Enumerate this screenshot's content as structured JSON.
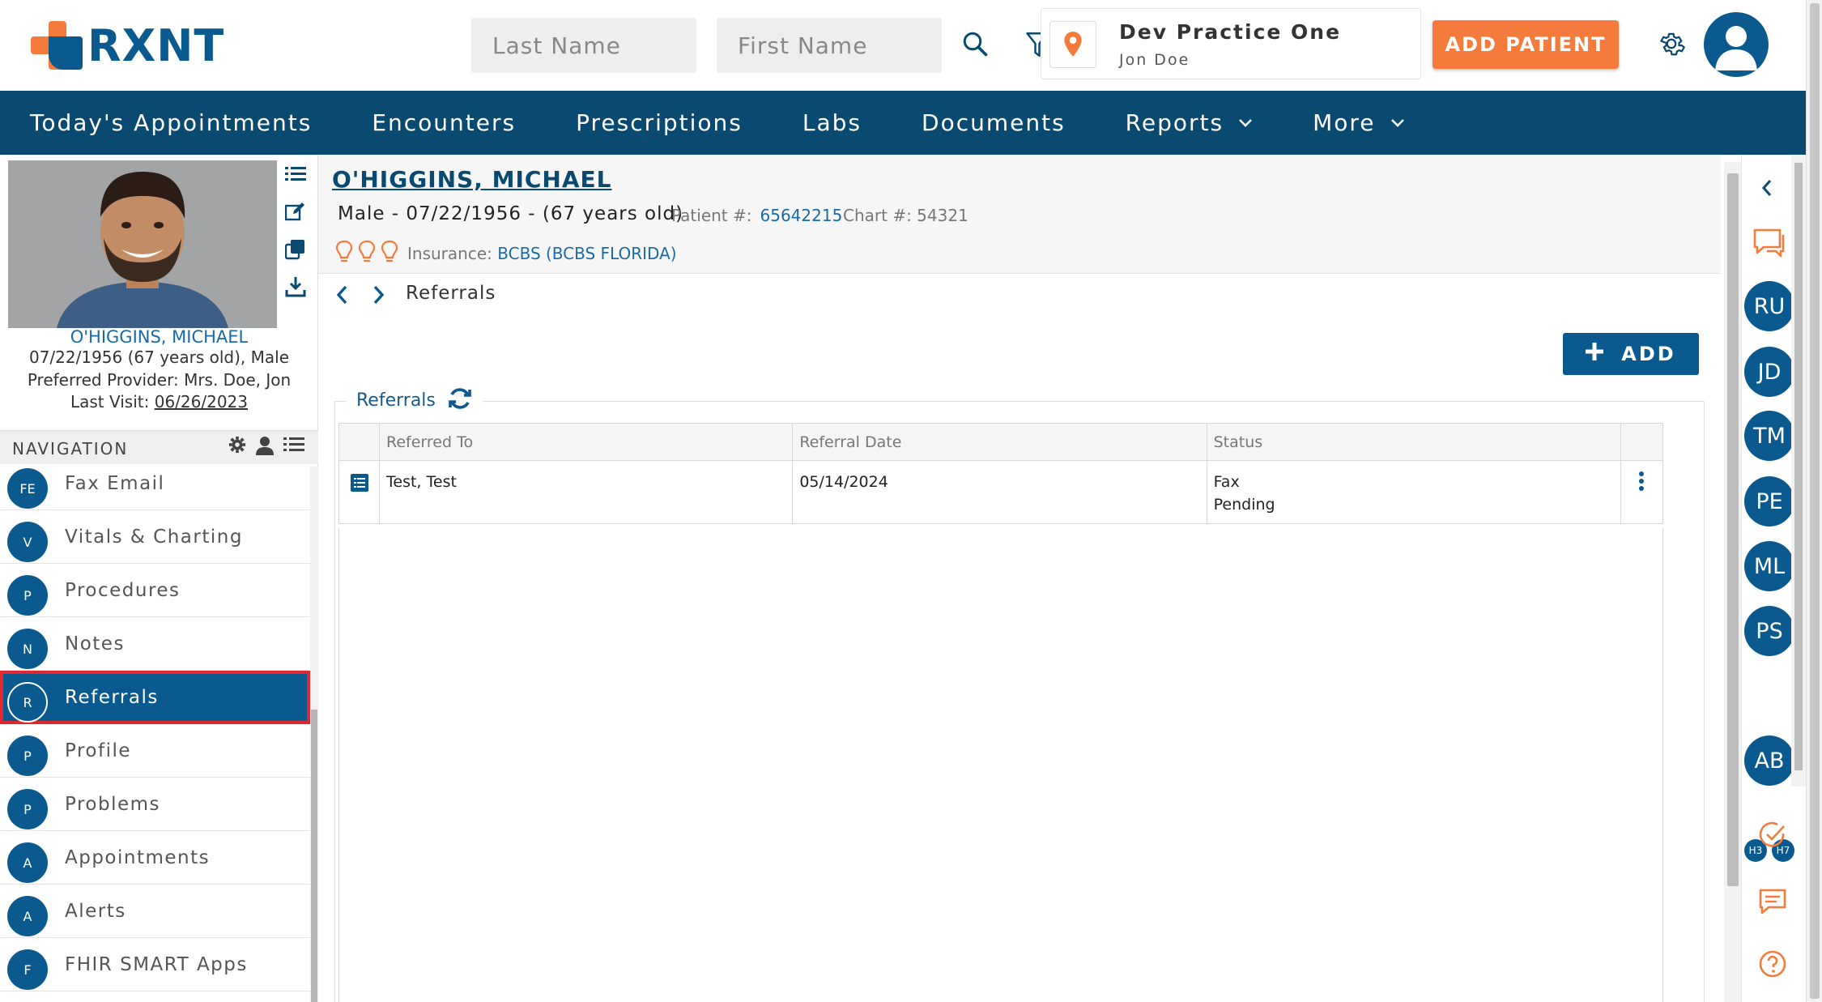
{
  "header": {
    "logo_text": "RXNT",
    "last_name_placeholder": "Last Name",
    "first_name_placeholder": "First Name",
    "practice_name": "Dev Practice One",
    "practice_user": "Jon Doe",
    "add_patient_label": "ADD PATIENT"
  },
  "mainnav": {
    "items": [
      {
        "label": "Today's Appointments"
      },
      {
        "label": "Encounters"
      },
      {
        "label": "Prescriptions"
      },
      {
        "label": "Labs"
      },
      {
        "label": "Documents"
      },
      {
        "label": "Reports"
      },
      {
        "label": "More"
      }
    ]
  },
  "patient_card": {
    "name": "O'HIGGINS, MICHAEL",
    "dob_line": "07/22/1956 (67 years old), Male",
    "provider_line": "Preferred Provider: Mrs. Doe, Jon",
    "last_visit_label": "Last Visit:",
    "last_visit_date": "06/26/2023"
  },
  "navigation": {
    "title": "NAVIGATION",
    "items": [
      {
        "abbr": "FE",
        "label": "Fax Email"
      },
      {
        "abbr": "V",
        "label": "Vitals & Charting"
      },
      {
        "abbr": "P",
        "label": "Procedures"
      },
      {
        "abbr": "N",
        "label": "Notes"
      },
      {
        "abbr": "R",
        "label": "Referrals"
      },
      {
        "abbr": "P",
        "label": "Profile"
      },
      {
        "abbr": "P",
        "label": "Problems"
      },
      {
        "abbr": "A",
        "label": "Appointments"
      },
      {
        "abbr": "A",
        "label": "Alerts"
      },
      {
        "abbr": "F",
        "label": "FHIR SMART Apps"
      }
    ],
    "active_index": 4
  },
  "patient_header": {
    "name": "O'HIGGINS, MICHAEL",
    "demographics": "Male - 07/22/1956 - (67 years old)",
    "patient_num_label": "Patient #:",
    "patient_num": "65642215",
    "chart_num": "Chart #: 54321",
    "insurance_label": "Insurance:",
    "insurance_value": "BCBS (BCBS FLORIDA)"
  },
  "breadcrumb": {
    "title": "Referrals"
  },
  "add_button_label": "ADD",
  "referrals_panel": {
    "title": "Referrals",
    "columns": [
      "Referred To",
      "Referral Date",
      "Status"
    ],
    "rows": [
      {
        "referred_to": "Test, Test",
        "date": "05/14/2024",
        "status_line1": "Fax",
        "status_line2": "Pending"
      }
    ]
  },
  "rail": {
    "bubbles": [
      "RU",
      "JD",
      "TM",
      "PE",
      "ML",
      "PS"
    ],
    "mini": [
      "H3",
      "H7"
    ],
    "last_bubble": "AB"
  },
  "colors": {
    "brand_blue": "#0a5a8f",
    "nav_blue": "#0a4a70",
    "accent_orange": "#f47b3c",
    "active_outline": "#e0262e"
  }
}
